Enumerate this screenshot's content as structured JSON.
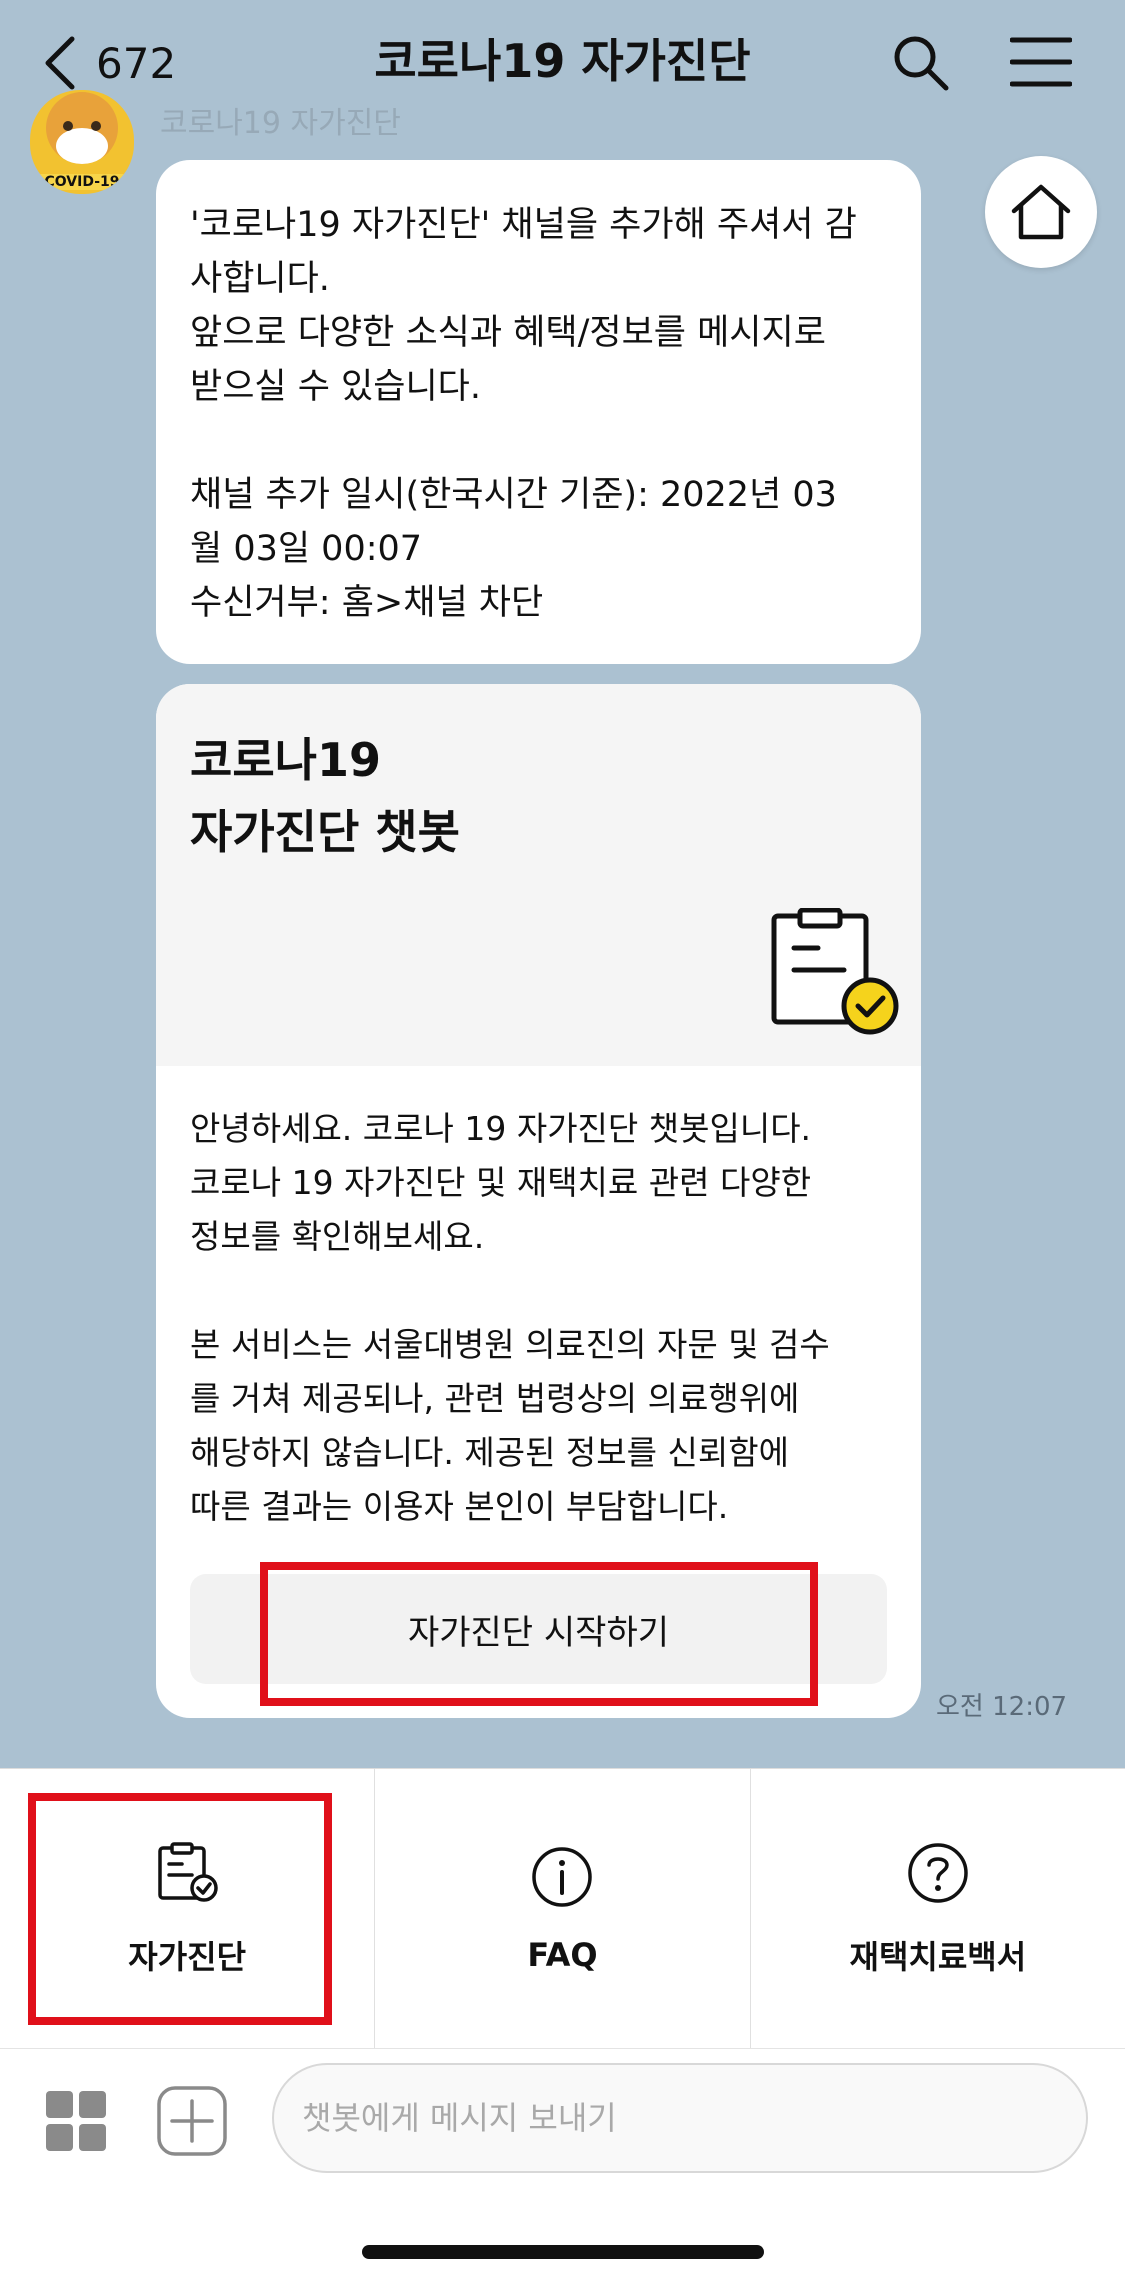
{
  "header": {
    "back_count": "672",
    "title": "코로나19 자가진단"
  },
  "avatar": {
    "tag": "COVID-19"
  },
  "sender_name": "코로나19 자가진단",
  "message1": {
    "text": "'코로나19 자가진단' 채널을 추가해 주셔서 감\n사합니다.\n앞으로 다양한 소식과 혜택/정보를 메시지로\n받으실 수 있습니다.\n\n채널 추가 일시(한국시간 기준): 2022년 03\n월 03일 00:07\n수신거부: 홈>채널 차단"
  },
  "card": {
    "title_line1": "코로나19",
    "title_line2": "자가진단 챗봇",
    "body_paragraph1": "안녕하세요. 코로나 19 자가진단 챗봇입니다.\n코로나 19 자가진단 및 재택치료 관련 다양한\n정보를 확인해보세요.",
    "body_paragraph2": "본 서비스는 서울대병원 의료진의 자문 및 검수\n를 거쳐 제공되나, 관련 법령상의 의료행위에\n해당하지 않습니다. 제공된 정보를 신뢰함에\n따른 결과는 이용자 본인이 부담합니다.",
    "button_label": "자가진단 시작하기"
  },
  "time_label": "오전 12:07",
  "quick_menu": {
    "items": [
      {
        "label": "자가진단",
        "icon": "clipboard-check-icon"
      },
      {
        "label": "FAQ",
        "icon": "info-icon"
      },
      {
        "label": "재택치료백서",
        "icon": "question-icon"
      }
    ]
  },
  "input": {
    "placeholder": "챗봇에게 메시지 보내기"
  },
  "colors": {
    "chat_background": "#abc1d1",
    "highlight_red": "#e0101a",
    "check_yellow": "#f5d31c"
  }
}
